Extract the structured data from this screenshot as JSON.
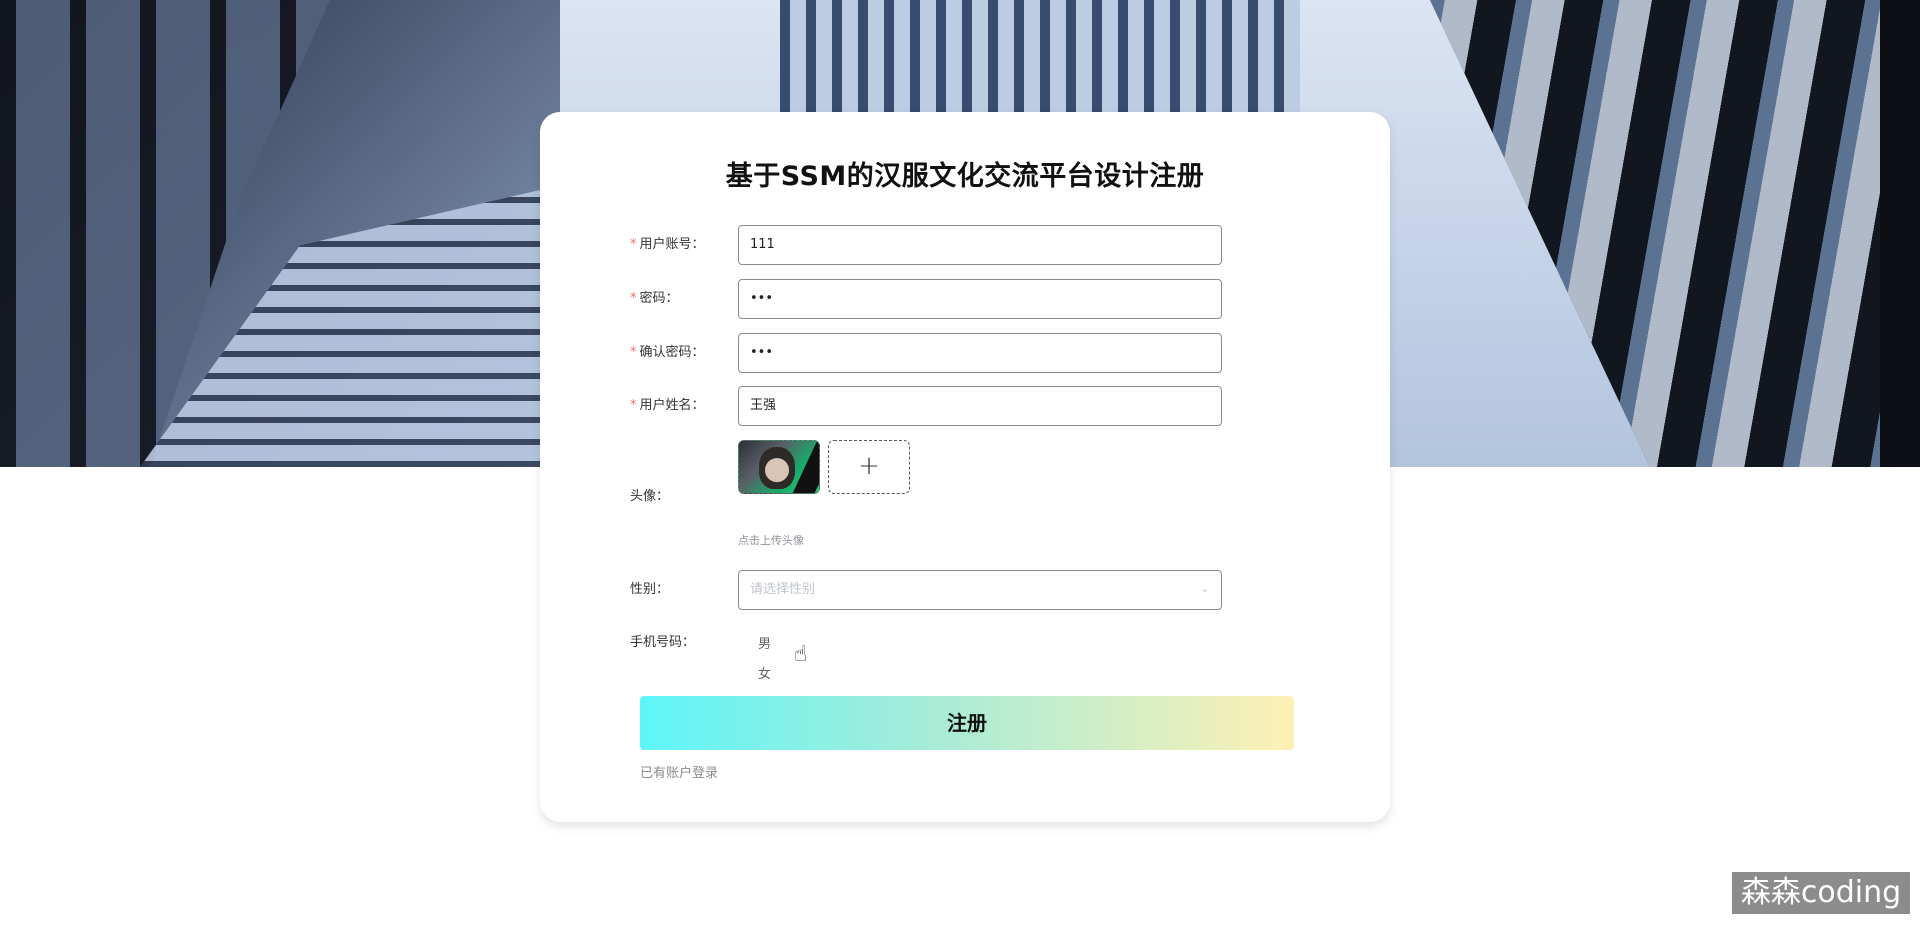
{
  "page": {
    "title": "基于SSM的汉服文化交流平台设计注册"
  },
  "form": {
    "username": {
      "label": "用户账号：",
      "value": "111",
      "required": true
    },
    "password": {
      "label": "密码：",
      "value": "•••",
      "required": true
    },
    "confirm_password": {
      "label": "确认密码：",
      "value": "•••",
      "required": true
    },
    "real_name": {
      "label": "用户姓名：",
      "value": "王强",
      "required": true
    },
    "avatar": {
      "label": "头像：",
      "upload_icon": "plus-icon",
      "hint": "点击上传头像"
    },
    "gender": {
      "label": "性别：",
      "placeholder": "请选择性别",
      "arrow_icon": "chevron-down-icon",
      "options": [
        "男",
        "女"
      ]
    },
    "phone": {
      "label": "手机号码："
    }
  },
  "actions": {
    "register_label": "注册",
    "login_link": "已有账户登录"
  },
  "watermark": "森森coding",
  "colors": {
    "required_star": "#f56c6c",
    "button_gradient_start": "#5ef5f8",
    "button_gradient_end": "#fdf0b4"
  }
}
